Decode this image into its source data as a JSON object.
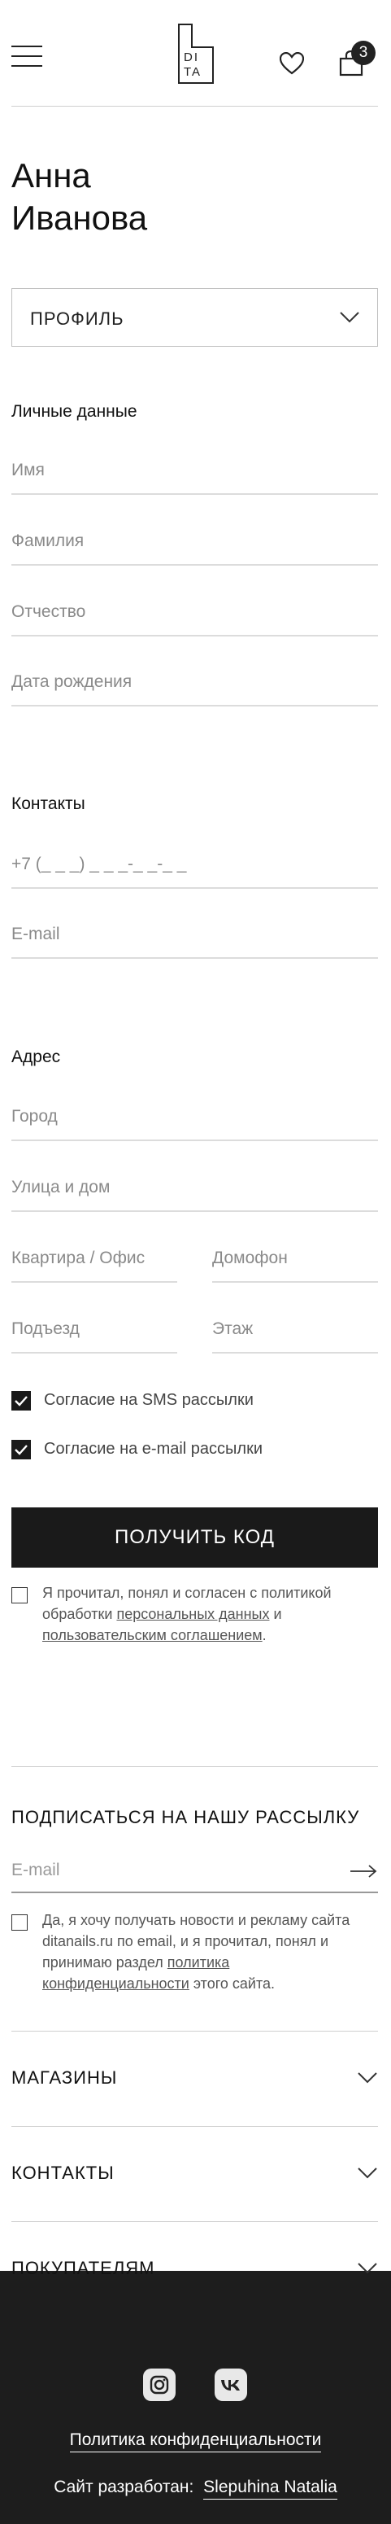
{
  "header": {
    "logo_text": "DI TA",
    "cart_count": "3"
  },
  "user": {
    "first_line": "Анна",
    "second_line": "Иванова"
  },
  "profile_select": {
    "label": "ПРОФИЛЬ"
  },
  "personal": {
    "title": "Личные данные",
    "first_name_placeholder": "Имя",
    "last_name_placeholder": "Фамилия",
    "middle_name_placeholder": "Отчество",
    "birthdate_placeholder": "Дата рождения"
  },
  "contacts": {
    "title": "Контакты",
    "phone_placeholder": "+7 (_ _ _) _ _ _-_ _-_ _",
    "email_placeholder": "E-mail"
  },
  "address": {
    "title": "Адрес",
    "city_placeholder": "Город",
    "street_placeholder": "Улица и дом",
    "apartment_placeholder": "Квартира / Офис",
    "intercom_placeholder": "Домофон",
    "entrance_placeholder": "Подъезд",
    "floor_placeholder": "Этаж"
  },
  "consents": {
    "sms_label": "Согласие на SMS рассылки",
    "email_label": "Согласие на e-mail рассылки"
  },
  "get_code_button": "ПОЛУЧИТЬ КОД",
  "policy": {
    "text_before": "Я прочитал, понял и согласен с политикой обработки ",
    "link1": "персональных данных",
    "text_mid": " и ",
    "link2": "пользовательским соглашением",
    "text_after": "."
  },
  "newsletter": {
    "title": "ПОДПИСАТЬСЯ НА НАШУ РАССЫЛКУ",
    "email_placeholder": "E-mail",
    "consent_before": "Да, я хочу получать новости и рекламу сайта ditanails.ru по email, и я прочитал, понял и принимаю раздел ",
    "consent_link": "политика конфиденциальности",
    "consent_after": " этого сайта."
  },
  "accordion": {
    "stores": "МАГАЗИНЫ",
    "contacts": "КОНТАКТЫ",
    "buyers": "ПОКУПАТЕЛЯМ"
  },
  "footer": {
    "privacy_link": "Политика конфиденциальности",
    "dev_label": "Сайт разработан:",
    "dev_name": "Slepuhina Natalia"
  },
  "colors": {
    "accent_dark": "#1a1a1a",
    "footer_bg": "#1d1d1d"
  }
}
